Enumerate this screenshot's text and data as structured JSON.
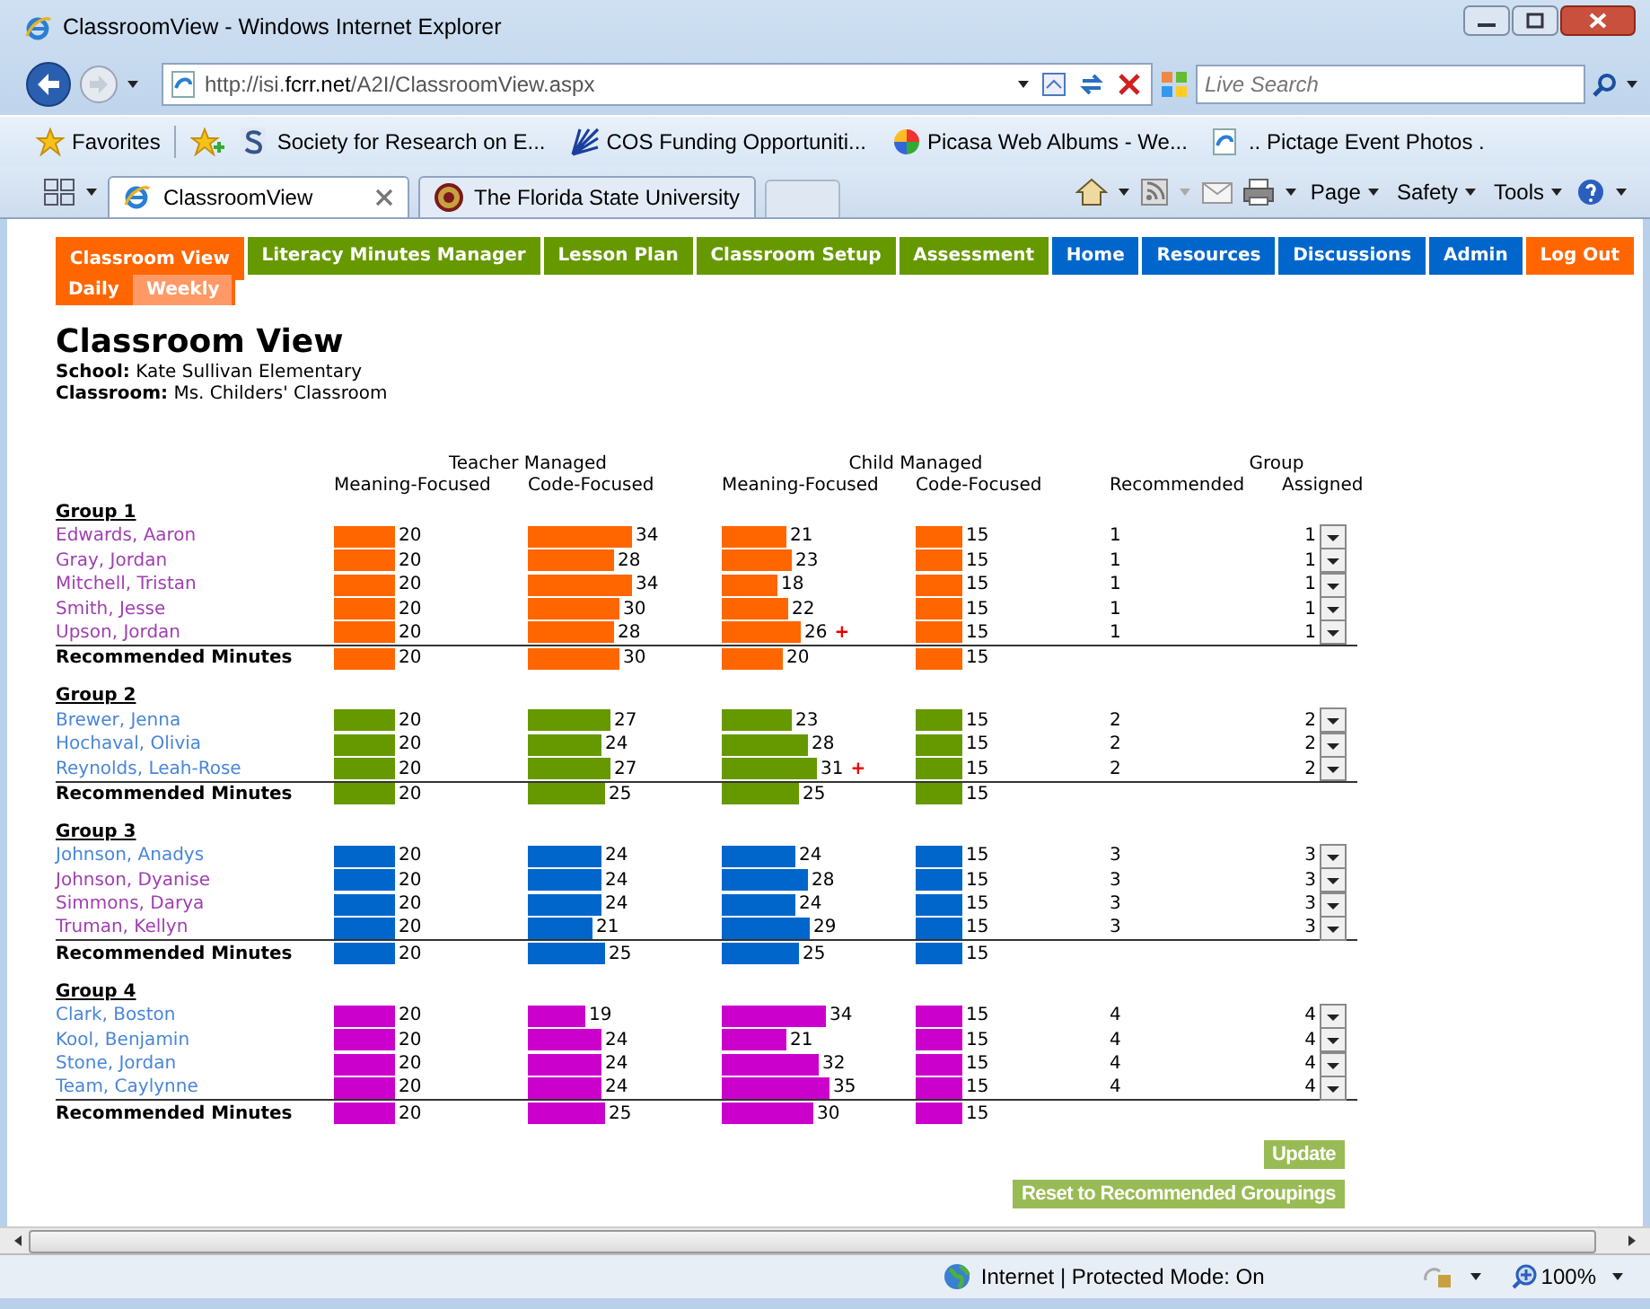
{
  "window": {
    "title": "ClassroomView - Windows Internet Explorer"
  },
  "address_bar": {
    "url": "http://isi.**fcrr.net**/A2I/ClassroomView.aspx"
  },
  "search": {
    "placeholder": "Live Search"
  },
  "favorites_bar": {
    "label": "Favorites",
    "links": [
      {
        "label": "Society for Research on E...",
        "kind": "letter"
      },
      {
        "label": "COS Funding Opportuniti...",
        "kind": "fan"
      },
      {
        "label": "Picasa Web Albums - We...",
        "kind": "pinwheel"
      },
      {
        "label": ".. Pictage  Event Photos .",
        "kind": "page"
      }
    ]
  },
  "browser_tabs": [
    {
      "label": "ClassroomView",
      "selected": true,
      "kind": "ie"
    },
    {
      "label": "The Florida State University",
      "selected": false,
      "kind": "seal"
    }
  ],
  "command_bar": [
    "Page",
    "Safety",
    "Tools"
  ],
  "nav_tabs": [
    {
      "label": "Classroom View",
      "color": "#ff6600",
      "selected": true
    },
    {
      "label": "Literacy Minutes Manager",
      "color": "#669900",
      "selected": false
    },
    {
      "label": "Lesson Plan",
      "color": "#669900",
      "selected": false
    },
    {
      "label": "Classroom Setup",
      "color": "#669900",
      "selected": false
    },
    {
      "label": "Assessment",
      "color": "#669900",
      "selected": false
    },
    {
      "label": "Home",
      "color": "#0066cc",
      "selected": false
    },
    {
      "label": "Resources",
      "color": "#0066cc",
      "selected": false
    },
    {
      "label": "Discussions",
      "color": "#0066cc",
      "selected": false
    },
    {
      "label": "Admin",
      "color": "#0066cc",
      "selected": false
    },
    {
      "label": "Log Out",
      "color": "#ff6600",
      "selected": false
    }
  ],
  "sub_tabs": [
    {
      "label": "Daily",
      "selected": true
    },
    {
      "label": "Weekly",
      "selected": false
    }
  ],
  "heading": "Classroom View",
  "school": "**School:** Kate Sullivan Elementary",
  "classroom": "**Classroom:** Ms. Childers' Classroom",
  "table": {
    "group_headers": [
      "Teacher Managed",
      "Child Managed",
      "Group"
    ],
    "columns": [
      "Meaning-Focused",
      "Code-Focused",
      "Meaning-Focused",
      "Code-Focused",
      "Recommended",
      "Assigned"
    ],
    "groups": [
      {
        "title": "Group 1",
        "color": "#ff6600",
        "students": [
          {
            "name": "Edwards, Aaron",
            "visited": true,
            "cells": [
              {
                "value": "20"
              },
              {
                "value": "34"
              },
              {
                "value": "21"
              },
              {
                "value": "15"
              }
            ],
            "recommended": "1",
            "assigned": "1"
          },
          {
            "name": "Gray, Jordan",
            "visited": true,
            "cells": [
              {
                "value": "20"
              },
              {
                "value": "28"
              },
              {
                "value": "23"
              },
              {
                "value": "15"
              }
            ],
            "recommended": "1",
            "assigned": "1"
          },
          {
            "name": "Mitchell, Tristan",
            "visited": true,
            "cells": [
              {
                "value": "20"
              },
              {
                "value": "34"
              },
              {
                "value": "18"
              },
              {
                "value": "15"
              }
            ],
            "recommended": "1",
            "assigned": "1"
          },
          {
            "name": "Smith, Jesse",
            "visited": true,
            "cells": [
              {
                "value": "20"
              },
              {
                "value": "30"
              },
              {
                "value": "22"
              },
              {
                "value": "15"
              }
            ],
            "recommended": "1",
            "assigned": "1"
          },
          {
            "name": "Upson, Jordan",
            "visited": true,
            "cells": [
              {
                "value": "20"
              },
              {
                "value": "28"
              },
              {
                "value": "26",
                "note": "+"
              },
              {
                "value": "15"
              }
            ],
            "recommended": "1",
            "assigned": "1"
          }
        ],
        "recommended_row": {
          "label": "Recommended Minutes",
          "cells": [
            {
              "value": "20"
            },
            {
              "value": "30"
            },
            {
              "value": "20"
            },
            {
              "value": "15"
            }
          ]
        }
      },
      {
        "title": "Group 2",
        "color": "#669900",
        "students": [
          {
            "name": "Brewer, Jenna",
            "visited": false,
            "cells": [
              {
                "value": "20"
              },
              {
                "value": "27"
              },
              {
                "value": "23"
              },
              {
                "value": "15"
              }
            ],
            "recommended": "2",
            "assigned": "2"
          },
          {
            "name": "Hochaval, Olivia",
            "visited": false,
            "cells": [
              {
                "value": "20"
              },
              {
                "value": "24"
              },
              {
                "value": "28"
              },
              {
                "value": "15"
              }
            ],
            "recommended": "2",
            "assigned": "2"
          },
          {
            "name": "Reynolds, Leah-Rose",
            "visited": false,
            "cells": [
              {
                "value": "20"
              },
              {
                "value": "27"
              },
              {
                "value": "31",
                "note": "+"
              },
              {
                "value": "15"
              }
            ],
            "recommended": "2",
            "assigned": "2"
          }
        ],
        "recommended_row": {
          "label": "Recommended Minutes",
          "cells": [
            {
              "value": "20"
            },
            {
              "value": "25"
            },
            {
              "value": "25"
            },
            {
              "value": "15"
            }
          ]
        }
      },
      {
        "title": "Group 3",
        "color": "#0066cc",
        "students": [
          {
            "name": "Johnson, Anadys",
            "visited": false,
            "cells": [
              {
                "value": "20"
              },
              {
                "value": "24"
              },
              {
                "value": "24"
              },
              {
                "value": "15"
              }
            ],
            "recommended": "3",
            "assigned": "3"
          },
          {
            "name": "Johnson, Dyanise",
            "visited": true,
            "cells": [
              {
                "value": "20"
              },
              {
                "value": "24"
              },
              {
                "value": "28"
              },
              {
                "value": "15"
              }
            ],
            "recommended": "3",
            "assigned": "3"
          },
          {
            "name": "Simmons, Darya",
            "visited": true,
            "cells": [
              {
                "value": "20"
              },
              {
                "value": "24"
              },
              {
                "value": "24"
              },
              {
                "value": "15"
              }
            ],
            "recommended": "3",
            "assigned": "3"
          },
          {
            "name": "Truman, Kellyn",
            "visited": true,
            "cells": [
              {
                "value": "20"
              },
              {
                "value": "21"
              },
              {
                "value": "29"
              },
              {
                "value": "15"
              }
            ],
            "recommended": "3",
            "assigned": "3"
          }
        ],
        "recommended_row": {
          "label": "Recommended Minutes",
          "cells": [
            {
              "value": "20"
            },
            {
              "value": "25"
            },
            {
              "value": "25"
            },
            {
              "value": "15"
            }
          ]
        }
      },
      {
        "title": "Group 4",
        "color": "#cc00cc",
        "students": [
          {
            "name": "Clark, Boston",
            "visited": false,
            "cells": [
              {
                "value": "20"
              },
              {
                "value": "19"
              },
              {
                "value": "34"
              },
              {
                "value": "15"
              }
            ],
            "recommended": "4",
            "assigned": "4"
          },
          {
            "name": "Kool, Benjamin",
            "visited": false,
            "cells": [
              {
                "value": "20"
              },
              {
                "value": "24"
              },
              {
                "value": "21"
              },
              {
                "value": "15"
              }
            ],
            "recommended": "4",
            "assigned": "4"
          },
          {
            "name": "Stone, Jordan",
            "visited": false,
            "cells": [
              {
                "value": "20"
              },
              {
                "value": "24"
              },
              {
                "value": "32"
              },
              {
                "value": "15"
              }
            ],
            "recommended": "4",
            "assigned": "4"
          },
          {
            "name": "Team, Caylynne",
            "visited": false,
            "cells": [
              {
                "value": "20"
              },
              {
                "value": "24"
              },
              {
                "value": "35"
              },
              {
                "value": "15"
              }
            ],
            "recommended": "4",
            "assigned": "4"
          }
        ],
        "recommended_row": {
          "label": "Recommended Minutes",
          "cells": [
            {
              "value": "20"
            },
            {
              "value": "25"
            },
            {
              "value": "30"
            },
            {
              "value": "15"
            }
          ]
        }
      }
    ]
  },
  "buttons": [
    "Update",
    "Reset to Recommended Groupings"
  ],
  "status_bar": {
    "zone": "Internet | Protected Mode: On",
    "zoom": "100%"
  }
}
